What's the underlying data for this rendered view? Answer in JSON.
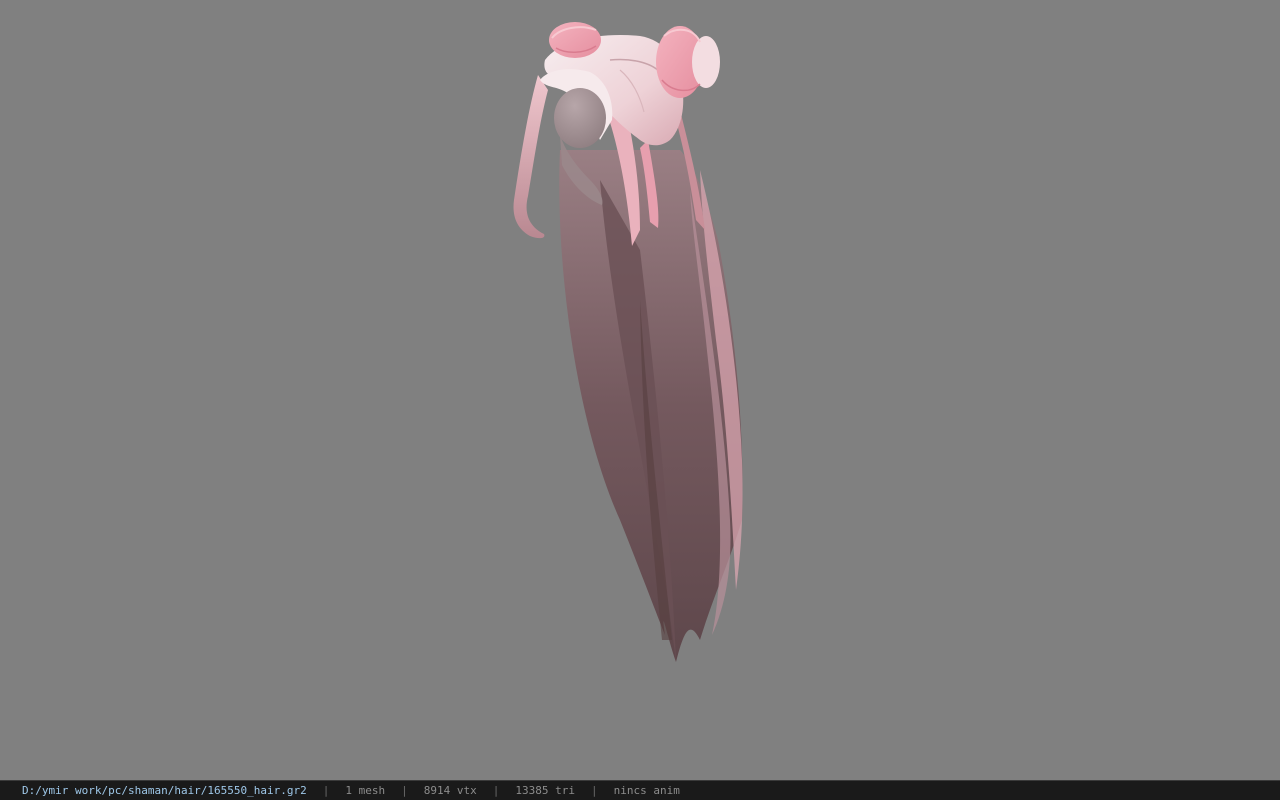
{
  "viewer": {
    "background_color": "#808080",
    "model_colors": {
      "hair_dark": "#6e5358",
      "hair_mid": "#8c6d72",
      "hair_pink": "#e9a7b3",
      "hair_light": "#f3e6e8"
    }
  },
  "status_bar": {
    "file_path": "D:/ymir work/pc/shaman/hair/165550_hair.gr2",
    "separator": "|",
    "mesh_count": "1 mesh",
    "vertex_count": "8914 vtx",
    "triangle_count": "13385 tri",
    "anim_status": "nincs anim"
  }
}
